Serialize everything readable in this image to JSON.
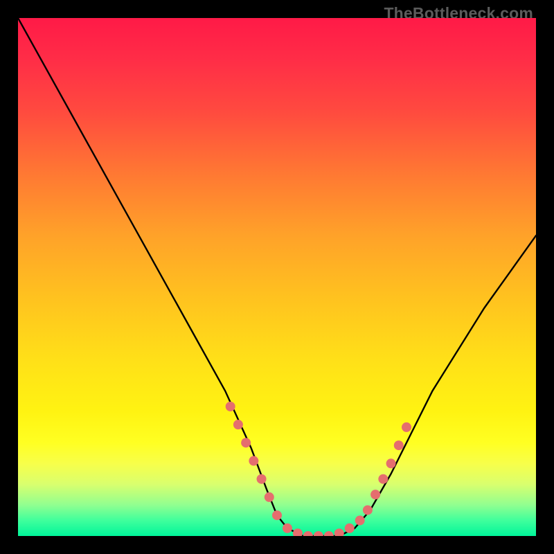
{
  "attribution": "TheBottleneck.com",
  "chart_data": {
    "type": "line",
    "title": "",
    "xlabel": "",
    "ylabel": "",
    "x_range": [
      0,
      100
    ],
    "y_range": [
      0,
      100
    ],
    "axes_visible": false,
    "grid": false,
    "background": "red-yellow-green vertical gradient",
    "series": [
      {
        "name": "bottleneck-curve",
        "stroke": "#000000",
        "x": [
          0,
          5,
          10,
          15,
          20,
          25,
          30,
          35,
          40,
          45,
          48,
          50,
          52,
          55,
          58,
          62,
          65,
          68,
          72,
          76,
          80,
          85,
          90,
          95,
          100
        ],
        "y": [
          100,
          91,
          82,
          73,
          64,
          55,
          46,
          37,
          28,
          17,
          9,
          4,
          1.5,
          0,
          0,
          0,
          1.5,
          5,
          12,
          20,
          28,
          36,
          44,
          51,
          58
        ]
      }
    ],
    "markers": {
      "name": "highlight-dots",
      "color": "#e56e6e",
      "radius_px": 7,
      "points": [
        {
          "x": 41,
          "y": 25
        },
        {
          "x": 42.5,
          "y": 21.5
        },
        {
          "x": 44,
          "y": 18
        },
        {
          "x": 45.5,
          "y": 14.5
        },
        {
          "x": 47,
          "y": 11
        },
        {
          "x": 48.5,
          "y": 7.5
        },
        {
          "x": 50,
          "y": 4
        },
        {
          "x": 52,
          "y": 1.5
        },
        {
          "x": 54,
          "y": 0.5
        },
        {
          "x": 56,
          "y": 0
        },
        {
          "x": 58,
          "y": 0
        },
        {
          "x": 60,
          "y": 0
        },
        {
          "x": 62,
          "y": 0.5
        },
        {
          "x": 64,
          "y": 1.5
        },
        {
          "x": 66,
          "y": 3
        },
        {
          "x": 67.5,
          "y": 5
        },
        {
          "x": 69,
          "y": 8
        },
        {
          "x": 70.5,
          "y": 11
        },
        {
          "x": 72,
          "y": 14
        },
        {
          "x": 73.5,
          "y": 17.5
        },
        {
          "x": 75,
          "y": 21
        }
      ]
    }
  }
}
